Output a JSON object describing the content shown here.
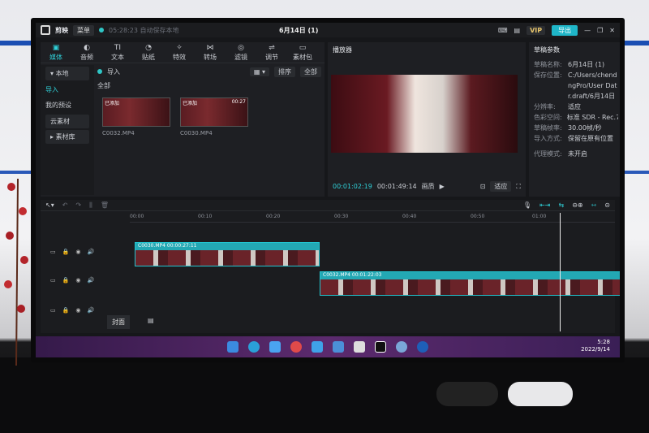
{
  "app": {
    "name": "剪映",
    "menu_label": "菜单",
    "autosave": "05:28:23 自动保存本地",
    "project_title": "6月14日 (1)",
    "vip_label": "VIP",
    "export_label": "导出"
  },
  "tools": [
    {
      "icon": "media-icon",
      "label": "媒体"
    },
    {
      "icon": "audio-icon",
      "label": "音频"
    },
    {
      "icon": "text-icon",
      "label": "文本"
    },
    {
      "icon": "sticker-icon",
      "label": "贴纸"
    },
    {
      "icon": "effects-icon",
      "label": "特效"
    },
    {
      "icon": "transition-icon",
      "label": "转场"
    },
    {
      "icon": "filter-icon",
      "label": "滤镜"
    },
    {
      "icon": "adjust-icon",
      "label": "调节"
    },
    {
      "icon": "package-icon",
      "label": "素材包"
    }
  ],
  "sidebar": {
    "local": "本地",
    "import": "导入",
    "preset": "我的预设",
    "cloud": "云素材",
    "library": "素材库"
  },
  "media": {
    "import_label": "导入",
    "sort_label": "排序",
    "all_filter": "全部",
    "section": "全部",
    "clips": [
      {
        "name": "C0032.MP4",
        "badge": "已添加",
        "duration": ""
      },
      {
        "name": "C0030.MP4",
        "badge": "已添加",
        "duration": "00:27"
      }
    ]
  },
  "player": {
    "title": "播放器",
    "current_time": "00:01:02:19",
    "total_time": "00:01:49:14",
    "quality": "画质",
    "ratio": "适应"
  },
  "params": {
    "title": "草稿参数",
    "rows": [
      {
        "k": "草稿名称:",
        "v": "6月14日 (1)"
      },
      {
        "k": "保存位置:",
        "v": "C:/Users/chend"
      },
      {
        "k": "",
        "v": "ngPro/User Dat"
      },
      {
        "k": "",
        "v": "r.draft/6月14日"
      },
      {
        "k": "分辨率:",
        "v": "适应"
      },
      {
        "k": "色彩空间:",
        "v": "标准 SDR - Rec.7"
      },
      {
        "k": "草稿帧率:",
        "v": "30.00帧/秒"
      },
      {
        "k": "导入方式:",
        "v": "保留在原有位置"
      },
      {
        "k": "代理模式:",
        "v": "未开启"
      }
    ]
  },
  "timeline": {
    "ticks": [
      "00:00",
      "00:10",
      "00:20",
      "00:30",
      "00:40",
      "00:50",
      "01:00"
    ],
    "clip1": "C0030.MP4  00:00:27:11",
    "clip2": "C0032.MP4  00:01:22:03",
    "cover": "封面"
  },
  "taskbar": {
    "time": "5:28",
    "date": "2022/9/14"
  },
  "colors": {
    "accent": "#2fd0d8",
    "export": "#1fb6c8",
    "bg": "#16171a"
  }
}
